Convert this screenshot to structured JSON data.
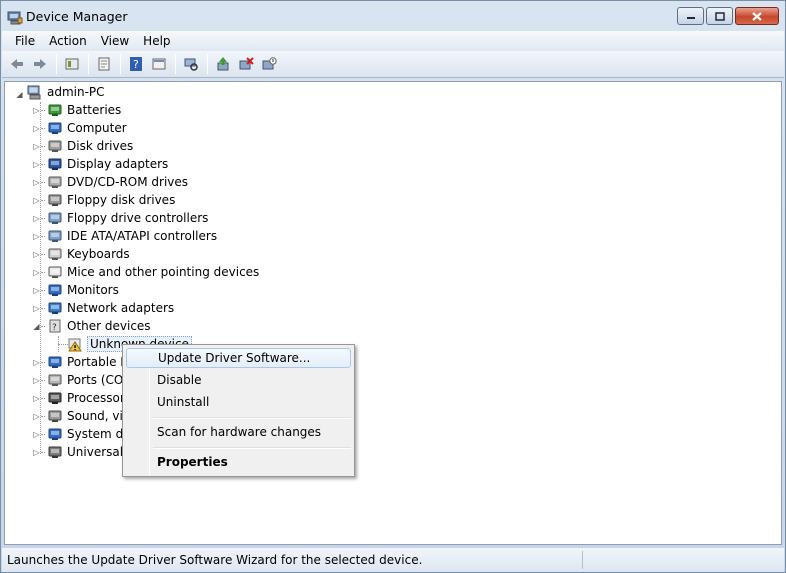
{
  "window": {
    "title": "Device Manager",
    "accent": "#c7462b"
  },
  "menu": [
    "File",
    "Action",
    "View",
    "Help"
  ],
  "toolbar": {
    "icons": [
      "back-icon",
      "forward-icon",
      "up-icon",
      "properties-icon",
      "help-icon",
      "show-hide-icon",
      "scan-icon",
      "update-driver-icon",
      "uninstall-icon",
      "disable-icon"
    ]
  },
  "tree": {
    "root": "admin-PC",
    "categories": [
      {
        "label": "Batteries",
        "icon": "battery-icon"
      },
      {
        "label": "Computer",
        "icon": "computer-icon"
      },
      {
        "label": "Disk drives",
        "icon": "disk-drive-icon"
      },
      {
        "label": "Display adapters",
        "icon": "display-adapter-icon"
      },
      {
        "label": "DVD/CD-ROM drives",
        "icon": "dvd-drive-icon"
      },
      {
        "label": "Floppy disk drives",
        "icon": "floppy-icon"
      },
      {
        "label": "Floppy drive controllers",
        "icon": "floppy-controller-icon"
      },
      {
        "label": "IDE ATA/ATAPI controllers",
        "icon": "ide-controller-icon"
      },
      {
        "label": "Keyboards",
        "icon": "keyboard-icon"
      },
      {
        "label": "Mice and other pointing devices",
        "icon": "mouse-icon"
      },
      {
        "label": "Monitors",
        "icon": "monitor-icon"
      },
      {
        "label": "Network adapters",
        "icon": "network-adapter-icon"
      },
      {
        "label": "Other devices",
        "icon": "other-devices-icon"
      },
      {
        "label": "Unknown device",
        "icon": "warning-device-icon",
        "child": true
      },
      {
        "label": "Portable D",
        "icon": "portable-device-icon"
      },
      {
        "label": "Ports (COM",
        "icon": "port-icon"
      },
      {
        "label": "Processors",
        "icon": "processor-icon"
      },
      {
        "label": "Sound, vic",
        "icon": "sound-icon"
      },
      {
        "label": "System de",
        "icon": "system-device-icon"
      },
      {
        "label": "Universal S",
        "icon": "usb-icon"
      }
    ]
  },
  "context_menu": {
    "items": [
      {
        "label": "Update Driver Software...",
        "highlighted": true
      },
      {
        "label": "Disable"
      },
      {
        "label": "Uninstall"
      },
      {
        "label": "Scan for hardware changes"
      },
      {
        "label": "Properties",
        "bold": true
      }
    ]
  },
  "status": {
    "text": "Launches the Update Driver Software Wizard for the selected device."
  }
}
